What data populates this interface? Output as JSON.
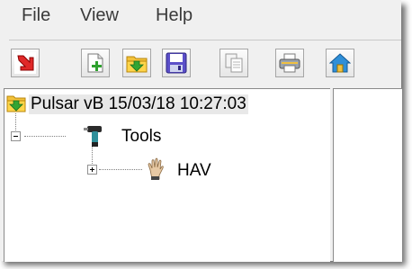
{
  "menu": {
    "file": "File",
    "view": "View",
    "help": "Help"
  },
  "toolbar": {
    "buttons": [
      {
        "icon": "import-arrow-icon"
      },
      {
        "icon": "new-document-icon"
      },
      {
        "icon": "open-folder-icon"
      },
      {
        "icon": "save-floppy-icon"
      },
      {
        "icon": "copy-document-icon"
      },
      {
        "icon": "printer-icon"
      },
      {
        "icon": "home-icon"
      }
    ]
  },
  "tree": {
    "root_label": "Pulsar vB 15/03/18 10:27:03",
    "tools_label": "Tools",
    "hav_label": "HAV",
    "tools_expanded": true,
    "hav_expanded": false
  },
  "colors": {
    "selection_background": "#e8e8e8",
    "tree_lines": "#808080"
  }
}
